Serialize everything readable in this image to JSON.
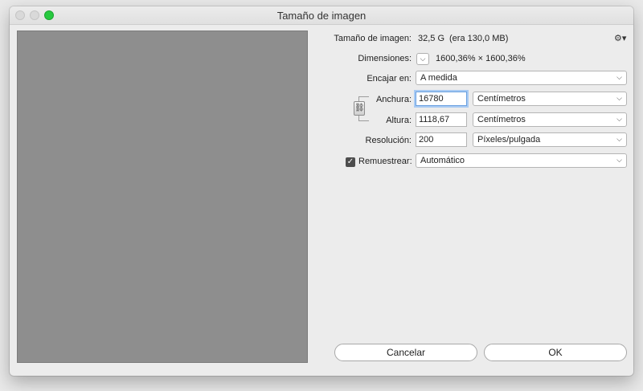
{
  "window": {
    "title": "Tamaño de imagen"
  },
  "info": {
    "size_label": "Tamaño de imagen:",
    "size_value": "32,5 G",
    "size_prev": "(era 130,0 MB)",
    "dimensions_label": "Dimensiones:",
    "dimensions_value": "1600,36% × 1600,36%"
  },
  "fit": {
    "label": "Encajar en:",
    "value": "A medida"
  },
  "width": {
    "label": "Anchura:",
    "value": "16780",
    "unit": "Centímetros"
  },
  "height": {
    "label": "Altura:",
    "value": "1118,67",
    "unit": "Centímetros"
  },
  "resolution": {
    "label": "Resolución:",
    "value": "200",
    "unit": "Píxeles/pulgada"
  },
  "resample": {
    "label": "Remuestrear:",
    "checked": true,
    "value": "Automático"
  },
  "buttons": {
    "cancel": "Cancelar",
    "ok": "OK"
  },
  "icons": {
    "gear": "gear-icon",
    "chevron": "chevron-down-icon",
    "link": "chain-link-icon",
    "check": "checkmark-icon"
  }
}
